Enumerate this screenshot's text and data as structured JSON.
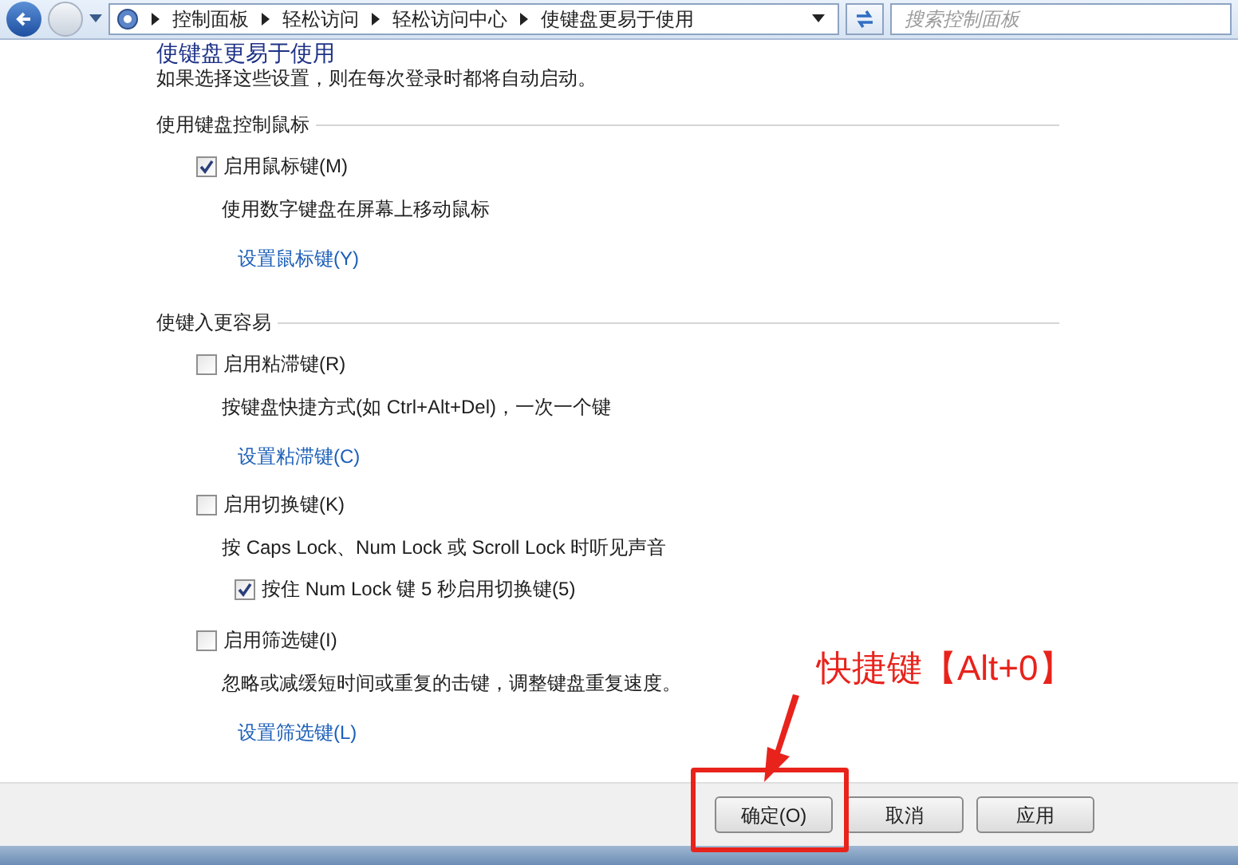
{
  "address_bar": {
    "breadcrumbs": [
      "控制面板",
      "轻松访问",
      "轻松访问中心",
      "使键盘更易于使用"
    ],
    "search": {
      "placeholder": "搜索控制面板"
    }
  },
  "page": {
    "title": "使键盘更易于使用",
    "intro": "如果选择这些设置，则在每次登录时都将自动启动。"
  },
  "sections": [
    {
      "heading": "使用键盘控制鼠标",
      "items": [
        {
          "label": "启用鼠标键(M)",
          "checked": true,
          "description": "使用数字键盘在屏幕上移动鼠标",
          "link": "设置鼠标键(Y)"
        }
      ]
    },
    {
      "heading": "使键入更容易",
      "items": [
        {
          "label": "启用粘滞键(R)",
          "checked": false,
          "description": "按键盘快捷方式(如 Ctrl+Alt+Del)，一次一个键",
          "link": "设置粘滞键(C)"
        },
        {
          "label": "启用切换键(K)",
          "checked": false,
          "description": "按 Caps Lock、Num Lock 或 Scroll Lock 时听见声音",
          "suboption": {
            "label": "按住 Num Lock 键 5 秒启用切换键(5)",
            "checked": true
          }
        },
        {
          "label": "启用筛选键(I)",
          "checked": false,
          "description": "忽略或减缓短时间或重复的击键，调整键盘重复速度。",
          "link": "设置筛选键(L)"
        }
      ]
    }
  ],
  "buttons": [
    "确定(O)",
    "取消",
    "应用"
  ],
  "annotation": {
    "text": "快捷键【Alt+0】"
  }
}
